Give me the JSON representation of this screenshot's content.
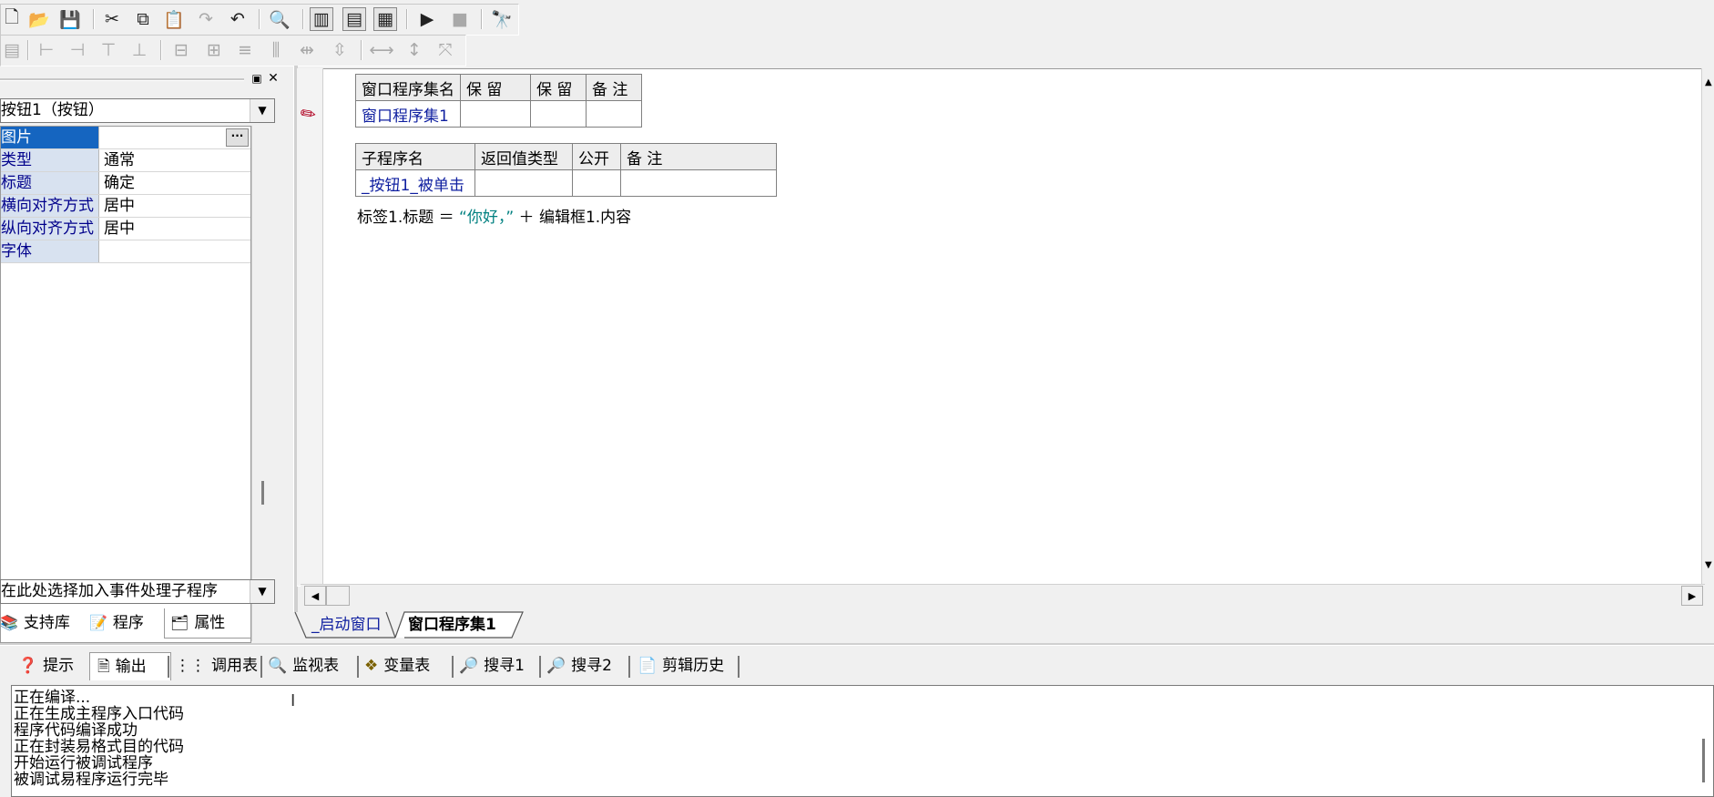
{
  "toolbar1": {
    "icons": [
      "new-file-icon",
      "open-folder-icon",
      "save-icon",
      "cut-icon",
      "copy-icon",
      "paste-icon",
      "redo-icon",
      "undo-icon",
      "find-icon",
      "layout1-icon",
      "layout2-icon",
      "layout3-icon",
      "run-icon",
      "stop-icon",
      "debug-icon"
    ]
  },
  "left_panel": {
    "component_combo": "按钮1（按钮）",
    "properties": [
      {
        "name": "图片",
        "value": ""
      },
      {
        "name": "类型",
        "value": "通常"
      },
      {
        "name": "标题",
        "value": "确定"
      },
      {
        "name": "横向对齐方式",
        "value": "居中"
      },
      {
        "name": "纵向对齐方式",
        "value": "居中"
      },
      {
        "name": "字体",
        "value": ""
      }
    ],
    "event_combo": "在此处选择加入事件处理子程序",
    "tabs": {
      "lib": "支持库",
      "prog": "程序",
      "prop": "属性"
    }
  },
  "editor": {
    "set_table": {
      "headers": [
        "窗口程序集名",
        "保 留",
        "保 留",
        "备 注"
      ],
      "row": [
        "窗口程序集1",
        "",
        "",
        ""
      ]
    },
    "sub_table": {
      "headers": [
        "子程序名",
        "返回值类型",
        "公开",
        "备 注"
      ],
      "row": [
        "_按钮1_被单击",
        "",
        "",
        ""
      ]
    },
    "code_line": {
      "part1": "标签1.标题 ＝ ",
      "string": "“你好，”",
      "part2": " ＋ 编辑框1.内容"
    },
    "tabs": {
      "start": "_启动窗口",
      "set": "窗口程序集1"
    }
  },
  "output_panel": {
    "tabs": {
      "hint": "提示",
      "output": "输出",
      "call": "调用表",
      "watch": "监视表",
      "vars": "变量表",
      "find1": "搜寻1",
      "find2": "搜寻2",
      "clip": "剪辑历史"
    },
    "lines": [
      "正在编译...",
      "正在生成主程序入口代码",
      "程序代码编译成功",
      "正在封装易格式目的代码",
      "开始运行被调试程序",
      "被调试易程序运行完毕"
    ]
  }
}
